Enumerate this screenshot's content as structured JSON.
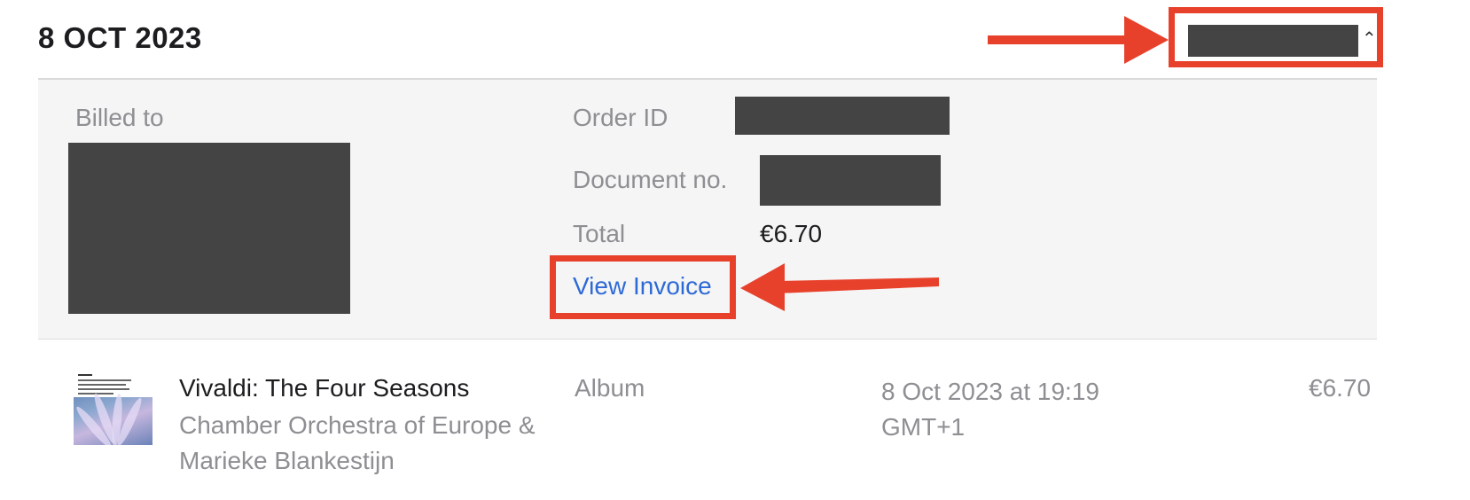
{
  "header": {
    "date": "8 OCT 2023",
    "toggle_icon": "chevron-up-icon",
    "toggle_glyph": "⌃"
  },
  "details": {
    "billed_to_label": "Billed to",
    "order_id_label": "Order ID",
    "document_no_label": "Document no.",
    "total_label": "Total",
    "total_value": "€6.70",
    "view_invoice_label": "View Invoice"
  },
  "item": {
    "title": "Vivaldi: The Four Seasons",
    "artist": "Chamber Orchestra of Europe & Marieke Blankestijn",
    "type": "Album",
    "date": "8 Oct 2023 at 19:19 GMT+1",
    "price": "€6.70",
    "art_text": "Vivaldi"
  },
  "colors": {
    "annotation_red": "#e8412b",
    "link_blue": "#2e6ad6",
    "redaction": "#444444",
    "panel_bg": "#f5f5f5"
  }
}
